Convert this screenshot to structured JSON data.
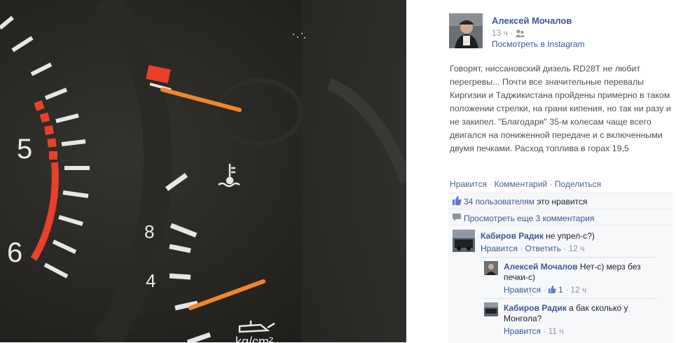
{
  "post": {
    "author": "Алексей Мочалов",
    "time": "13 ч",
    "insta_link": "Посмотреть в Instagram",
    "text": "Говорят, ниссановский дизель RD28T не любит перегревы... Почти все значительные перевалы Киргизии и Таджикистана пройдены примерно в таком положении стрелки, на грани кипения, но так ни разу и не закипел. \"Благодаря\" 35-м колесам чаще всего двигался на пониженной передаче и с включенными двумя печками. Расход топлива в горах 19,5"
  },
  "actions": {
    "like": "Нравится",
    "comment": "Комментарий",
    "share": "Поделиться",
    "sep": "·"
  },
  "likes": {
    "count_link": "34 пользователям",
    "suffix": "это нравится"
  },
  "more_comments": "Просмотреть еще 3 комментария",
  "comments": [
    {
      "author": "Кабиров Радик",
      "text": "не упрел-с?)",
      "like": "Нравится",
      "reply": "Ответить",
      "time": "12 ч"
    },
    {
      "author": "Алексей Мочалов",
      "text": "Нет-с) мерз без печки-с)",
      "like": "Нравится",
      "like_count": "1",
      "time": "12 ч"
    },
    {
      "author": "Кабиров Радик",
      "text": "а бак сколько у Монгола?",
      "like": "Нравится",
      "time": "11 ч"
    }
  ],
  "gauge": {
    "numbers": [
      "5",
      "6",
      "8",
      "4"
    ],
    "unit": "kg/cm²"
  },
  "colors": {
    "link": "#3b5998",
    "needle": "#f0862c",
    "redline": "#e8402a"
  }
}
